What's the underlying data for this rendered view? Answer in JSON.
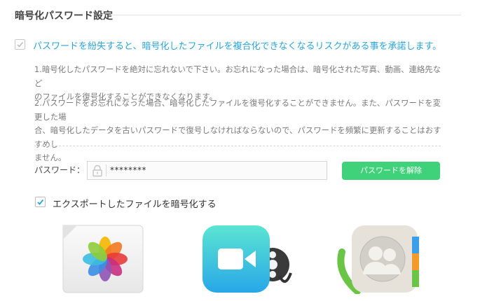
{
  "section": {
    "title": "暗号化パスワード設定"
  },
  "acknowledge": {
    "checked": true,
    "text": "パスワードを紛失すると、暗号化したファイルを複合化できなくなるリスクがある事を承諾します。"
  },
  "notes": [
    {
      "line1": "1.暗号化したパスワードを絶対に忘れないで下さい。お忘れになった場合は、暗号化された写真、動画、連絡先など",
      "line2": "のファイルを復号化することができなくなります。"
    },
    {
      "line1": "2.パスワードをお忘れになった場合、暗号化したファイルを復号化することができません。また、パスワードを変更した場",
      "line2": "合、暗号化したデータを古いパスワードで復号しなければならないので、パスワードを頻繁に更新することはおすすめし",
      "line3": "ません。"
    }
  ],
  "password": {
    "label": "パスワード：",
    "value": "********",
    "remove_button": "パスワードを解除"
  },
  "export": {
    "checked": true,
    "label": "エクスポートしたファイルを暗号化する"
  },
  "icons": [
    "photos-icon",
    "video-icon",
    "contacts-icon"
  ],
  "colors": {
    "accent_text": "#2aa4d6",
    "button": "#3fd27a",
    "check": "#2aa4d6"
  }
}
